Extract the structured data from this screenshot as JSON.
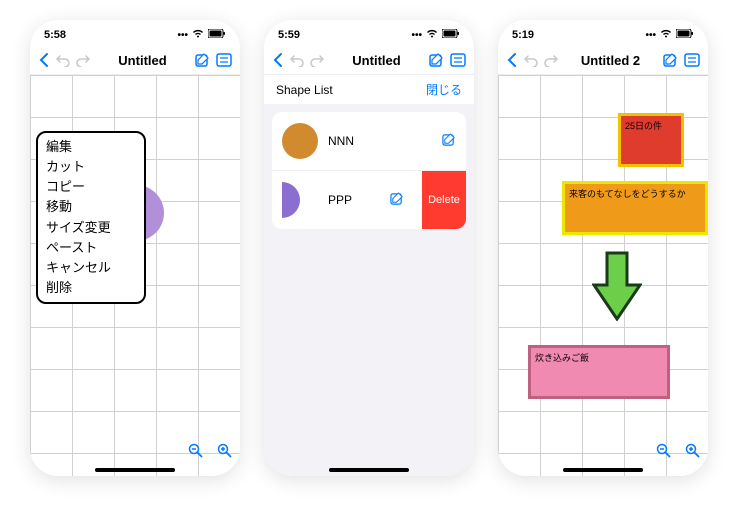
{
  "screens": [
    {
      "time": "5:58",
      "title": "Untitled",
      "contextMenu": [
        "編集",
        "カット",
        "コピー",
        "移動",
        "サイズ変更",
        "ペースト",
        "キャンセル",
        "削除"
      ],
      "zoomIn": "⊕",
      "zoomOut": "⊖"
    },
    {
      "time": "5:59",
      "title": "Untitled",
      "listHeader": "Shape List",
      "closeLabel": "閉じる",
      "rows": [
        {
          "label": "NNN",
          "color": "orange",
          "deletable": false
        },
        {
          "label": "PPP",
          "color": "purple",
          "deletable": true
        }
      ],
      "deleteLabel": "Delete"
    },
    {
      "time": "5:19",
      "title": "Untitled 2",
      "boxes": [
        {
          "text": "25日の件"
        },
        {
          "text": "来客のもてなしをどうするか"
        },
        {
          "text": "炊き込みご飯"
        }
      ],
      "zoomIn": "⊕",
      "zoomOut": "⊖"
    }
  ]
}
